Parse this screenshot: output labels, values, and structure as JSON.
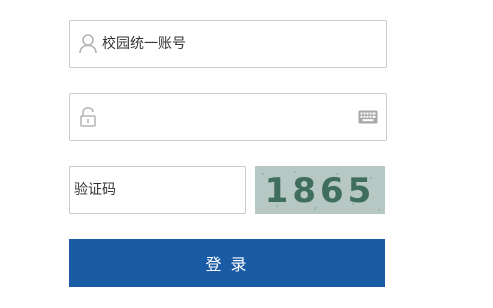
{
  "form": {
    "username": {
      "placeholder": "校园统一账号",
      "value": "",
      "icon": "user-icon"
    },
    "password": {
      "placeholder": "",
      "value": "",
      "icon": "lock-icon",
      "keyboard_icon": "keyboard-icon"
    },
    "captcha": {
      "placeholder": "验证码",
      "value": "",
      "image_text": "1865"
    },
    "login_label": "登 录"
  },
  "colors": {
    "button": "#1a5ba6",
    "border": "#cccccc",
    "icon": "#b5b5b5",
    "captcha_bg": "#b7c8c4"
  }
}
